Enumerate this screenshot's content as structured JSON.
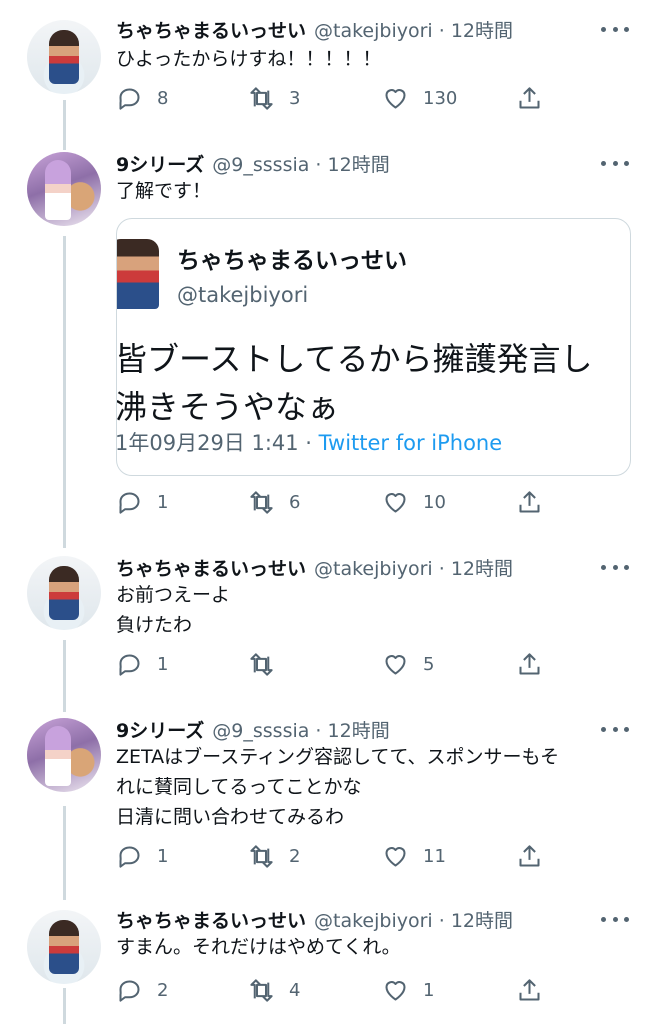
{
  "tweets": [
    {
      "name": "ちゃちゃまるいっせい",
      "handle": "@takejbiyori",
      "time": "12時間",
      "lines": [
        "ひよったからけすね！！！！！"
      ],
      "reply": "8",
      "retweet": "3",
      "like": "130"
    },
    {
      "name": "9シリーズ",
      "handle": "@9_ssssia",
      "time": "12時間",
      "lines": [
        "了解です！"
      ],
      "reply": "1",
      "retweet": "6",
      "like": "10",
      "quote": {
        "name": "ちゃちゃまるいっせい",
        "handle": "@takejbiyori",
        "text1": "皆ブーストしてるから擁護発言し",
        "text2": "沸きそうやなぁ",
        "date": "1年09月29日 1:41 · ",
        "source": "Twitter for iPhone"
      }
    },
    {
      "name": "ちゃちゃまるいっせい",
      "handle": "@takejbiyori",
      "time": "12時間",
      "lines": [
        "お前つえーよ",
        "負けたわ"
      ],
      "reply": "1",
      "retweet": "",
      "like": "5"
    },
    {
      "name": "9シリーズ",
      "handle": "@9_ssssia",
      "time": "12時間",
      "lines": [
        "ZETAはブースティング容認してて、スポンサーもそ",
        "れに賛同してるってことかな",
        "日清に問い合わせてみるわ"
      ],
      "reply": "1",
      "retweet": "2",
      "like": "11"
    },
    {
      "name": "ちゃちゃまるいっせい",
      "handle": "@takejbiyori",
      "time": "12時間",
      "lines": [
        "すまん。それだけはやめてくれ。"
      ],
      "reply": "2",
      "retweet": "4",
      "like": "1"
    }
  ]
}
